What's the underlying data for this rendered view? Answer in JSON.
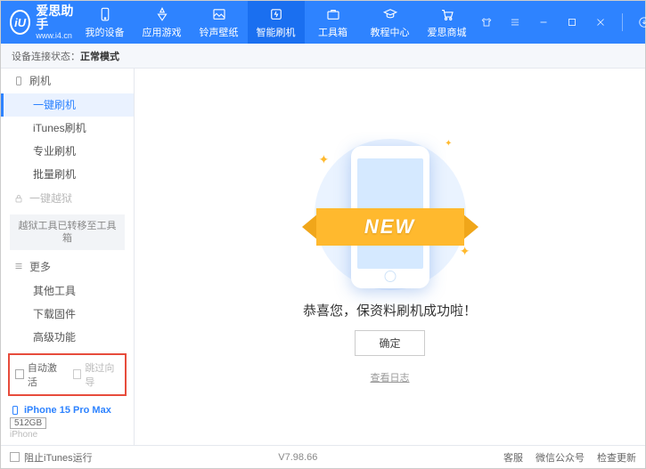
{
  "brand": {
    "title": "爱思助手",
    "sub": "www.i4.cn",
    "logo_letters": "iU"
  },
  "nav": {
    "items": [
      {
        "label": "我的设备"
      },
      {
        "label": "应用游戏"
      },
      {
        "label": "铃声壁纸"
      },
      {
        "label": "智能刷机"
      },
      {
        "label": "工具箱"
      },
      {
        "label": "教程中心"
      },
      {
        "label": "爱思商城"
      }
    ]
  },
  "status": {
    "prefix": "设备连接状态：",
    "value": "正常模式"
  },
  "sidebar": {
    "group_flash": "刷机",
    "items_flash": [
      "一键刷机",
      "iTunes刷机",
      "专业刷机",
      "批量刷机"
    ],
    "group_jailbreak": "一键越狱",
    "note_jailbreak": "越狱工具已转移至工具箱",
    "group_more": "更多",
    "items_more": [
      "其他工具",
      "下载固件",
      "高级功能"
    ],
    "checks": {
      "auto_activate": "自动激活",
      "skip_guide": "跳过向导"
    },
    "device": {
      "name": "iPhone 15 Pro Max",
      "storage": "512GB",
      "type": "iPhone"
    }
  },
  "main": {
    "ribbon": "NEW",
    "success": "恭喜您，保资料刷机成功啦！",
    "ok": "确定",
    "view_log": "查看日志"
  },
  "footer": {
    "block_itunes": "阻止iTunes运行",
    "version": "V7.98.66",
    "links": [
      "客服",
      "微信公众号",
      "检查更新"
    ]
  }
}
